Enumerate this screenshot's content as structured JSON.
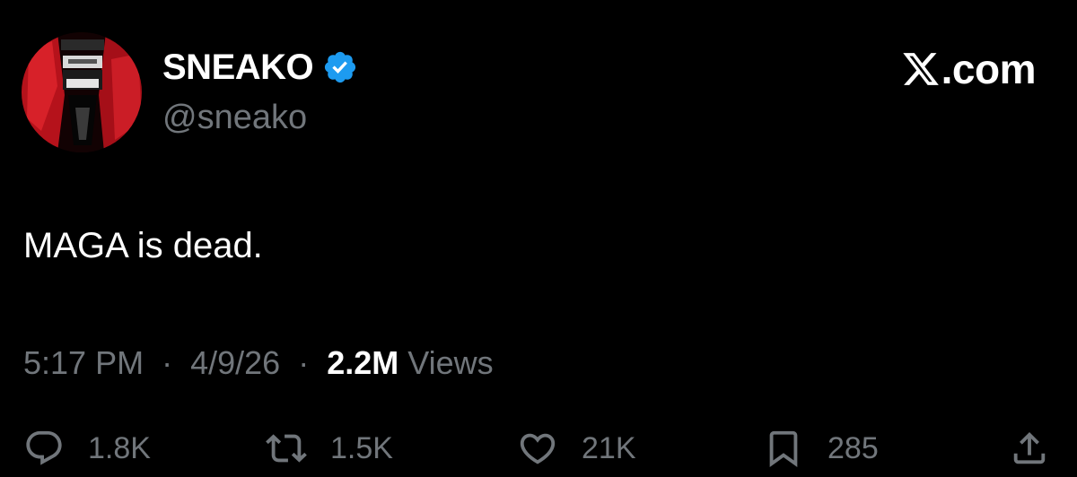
{
  "author": {
    "display_name": "SNEAKO",
    "handle": "@sneako",
    "verified": true
  },
  "brand": {
    "label": ".com",
    "icon": "x-logo-icon"
  },
  "tweet": {
    "text": "MAGA is dead.",
    "time": "5:17 PM",
    "date": "4/9/26",
    "separator": "·",
    "views_count": "2.2M",
    "views_label": "Views"
  },
  "actions": {
    "replies": "1.8K",
    "reposts": "1.5K",
    "likes": "21K",
    "bookmarks": "285"
  },
  "colors": {
    "background": "#000000",
    "primary_text": "#ffffff",
    "secondary_text": "#71767b",
    "verified_blue": "#1d9bf0",
    "avatar_red": "#b5121b"
  }
}
